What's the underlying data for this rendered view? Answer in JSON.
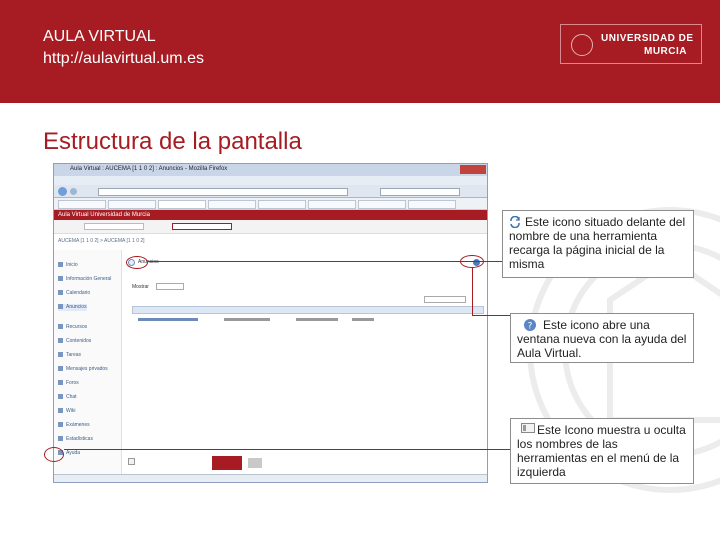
{
  "header": {
    "title": "AULA VIRTUAL",
    "url": "http://aulavirtual.um.es",
    "logo_line1": "UNIVERSIDAD DE",
    "logo_line2": "MURCIA"
  },
  "slide": {
    "title": "Estructura de la pantalla"
  },
  "callouts": {
    "refresh": "Este icono situado delante del nombre de una herramienta recarga la página inicial de la misma",
    "help": "Este icono abre una ventana nueva con la ayuda del Aula Virtual.",
    "toggle": "Este Icono muestra u oculta los nombres de las herramientas en el menú de la izquierda"
  },
  "screenshot": {
    "window_title": "Aula Virtual : AUCEMA [1 1 0 2] : Anuncios - Mozilla Firefox",
    "band_text": "Aula Virtual Universidad de Murcia",
    "breadcrumb": "AUCEMA [1 1 0 2] > AUCEMA [1 1 0 2]",
    "sidebar": [
      {
        "label": "Inicio",
        "selected": false
      },
      {
        "label": "Información General",
        "selected": false
      },
      {
        "label": "Calendario",
        "selected": false
      },
      {
        "label": "Anuncios",
        "selected": true
      },
      {
        "label": "Recursos",
        "selected": false
      },
      {
        "label": "Contenidos",
        "selected": false
      },
      {
        "label": "Tareas",
        "selected": false
      },
      {
        "label": "Mensajes privados",
        "selected": false
      },
      {
        "label": "Foros",
        "selected": false
      },
      {
        "label": "Chat",
        "selected": false
      },
      {
        "label": "Wiki",
        "selected": false
      },
      {
        "label": "Exámenes",
        "selected": false
      },
      {
        "label": "Estadísticas",
        "selected": false
      },
      {
        "label": "Ayuda",
        "selected": false
      }
    ],
    "main_title": "Anuncios",
    "show_label": "Mostrar",
    "colors": {
      "brand": "#a61c22",
      "link": "#3a5d8a"
    }
  },
  "icons": {
    "refresh": "refresh-icon",
    "help": "help-icon",
    "toggle": "menu-toggle-icon"
  }
}
